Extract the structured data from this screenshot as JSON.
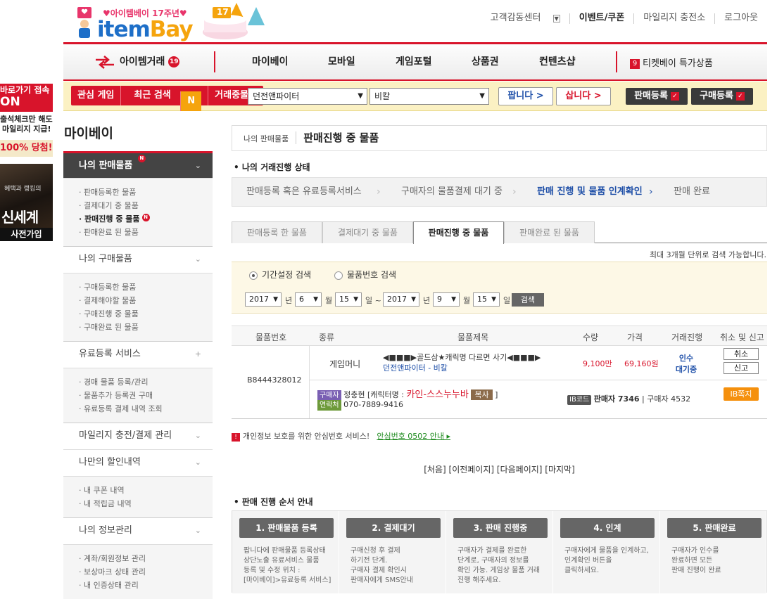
{
  "left_banners": {
    "banner1": {
      "line1": "바로가기 접속",
      "line2": "ON",
      "line3": "출석체크만 해도",
      "line4": "마일리지 지급!",
      "line5": "100% 당첨!"
    },
    "banner2": {
      "small": "혜택과 랭킹의",
      "big": "신세계",
      "cta": "사전가입"
    }
  },
  "logo": {
    "tagline": "♥아이템베이 17주년♥",
    "brand1": "item",
    "brand2": "Bay",
    "cake_number": "17"
  },
  "top_links": [
    "고객감동센터",
    "이벤트/쿠폰",
    "마일리지 충전소",
    "로그아웃"
  ],
  "nav": {
    "trade": "아이템거래",
    "trade_badge": "19",
    "items": [
      "마이베이",
      "모바일",
      "게임포털",
      "상품권",
      "컨텐츠샵"
    ],
    "ticket_num": "9",
    "ticket": "티켓베이 특가상품"
  },
  "search_bar": {
    "tabs": [
      "관심 게임",
      "최근 검색",
      "거래중물품"
    ],
    "new_badge": "N",
    "game_select": "던전앤파이터",
    "server_select": "비칼",
    "sell_btn": "팝니다 >",
    "buy_btn": "삽니다 >",
    "sell_reg": "판매등록",
    "buy_reg": "구매등록",
    "check": "✓"
  },
  "sidebar": {
    "title": "마이베이",
    "sections": [
      {
        "label": "나의 판매물품",
        "badge": "N",
        "items": [
          "· 판매등록한 물품",
          "· 결제대기 중 물품",
          "· 판매진행 중 물품",
          "· 판매완료 된 물품"
        ]
      },
      {
        "label": "나의 구매물품",
        "items": [
          "· 구매등록한 물품",
          "· 결제해야할 물품",
          "· 구매진행 중 물품",
          "· 구매완료 된 물품"
        ]
      },
      {
        "label": "유료등록 서비스",
        "items": [
          "· 경매 물품 등록/관리",
          "· 물품추가 등록권 구매",
          "· 유료등록 결제 내역 조회"
        ]
      },
      {
        "label": "마일리지 충전/결제 관리"
      },
      {
        "label": "나만의 할인내역",
        "items": [
          "· 내 쿠폰 내역",
          "· 내 적립금 내역"
        ]
      },
      {
        "label": "나의 정보관리",
        "items": [
          "· 계좌/회원정보 관리",
          "· 보상마크 상태 관리",
          "· 내 인증상태 관리"
        ]
      }
    ],
    "current_badge": "N"
  },
  "breadcrumb": {
    "parent": "나의 판매물품",
    "current": "판매진행 중 물품"
  },
  "status_section": {
    "title": "• 나의 거래진행 상태",
    "steps": [
      "판매등록 혹은 유료등록서비스",
      "구매자의 물품결제 대기 중",
      "판매 진행 및 물품 인계확인",
      "판매 완료"
    ],
    "sep": "›"
  },
  "tabs": [
    "판매등록 한 물품",
    "결제대기 중 물품",
    "판매진행 중 물품",
    "판매완료 된 물품"
  ],
  "search_note": "최대 3개월 단위로 검색 가능합니다.",
  "filter": {
    "radio1": "기간설정 검색",
    "radio2": "물품번호 검색",
    "from_year": "2017",
    "from_month": "6",
    "from_day": "15",
    "to_year": "2017",
    "to_month": "9",
    "to_day": "15",
    "unit_year": "년",
    "unit_month": "월",
    "unit_day": "일",
    "tilde": "~",
    "search_btn": "검색"
  },
  "table": {
    "headers": [
      "물품번호",
      "종류",
      "물품제목",
      "수량",
      "가격",
      "거래진행",
      "취소 및 신고"
    ],
    "row": {
      "item_no": "B8444328012",
      "type": "게임머니",
      "title": "◀■■■▶골드삼★캐릭명 다르면 사기◀■■■▶",
      "game": "던전앤파이터 - 비칼",
      "qty": "9,100만",
      "price": "69,160원",
      "status1": "인수",
      "status2": "대기중",
      "cancel": "취소",
      "report": "신고",
      "buyer_tag": "구매자",
      "buyer_name": "정충현 [캐릭터명 :",
      "char_name": "카인-스스누누바",
      "copy": "복사",
      "close_bracket": "]",
      "contact_tag": "연락처",
      "phone": "070-7889-9416",
      "ib_code_tag": "IB코드",
      "seller_code": "판매자 7346",
      "buyer_code": "| 구매자 4532",
      "ib_msg": "IB쪽지"
    }
  },
  "safe_notice": {
    "icon": "!",
    "text": "개인정보 보호를 위한 안심번호 서비스!",
    "link": "안심번호 0502 안내 ▸"
  },
  "pager": "[처음] [이전페이지] [다음페이지] [마지막]",
  "guide": {
    "title": "• 판매 진행 순서 안내",
    "steps": [
      {
        "title": "1. 판매물품 등록",
        "desc": "팝니다에 판매물품 등록상태\n상단노출 유료서비스 물품\n등록 및 수정 위치 :\n[마이베이]>유료등록 서비스]"
      },
      {
        "title": "2. 결제대기",
        "desc": "구매신청 후 결제\n하기전 단계.\n구매자 결제 확인시\n판매자에게 SMS안내"
      },
      {
        "title": "3. 판매 진행중",
        "desc": "구매자가 결제를 완료한\n단계로, 구매자의 정보를\n확인 가능. 게임상 물품 거래\n진행 해주세요."
      },
      {
        "title": "4. 인계",
        "desc": "구매자에게 물품을 인계하고,\n인계확인 버튼을\n클릭하세요."
      },
      {
        "title": "5. 판매완료",
        "desc": "구매자가 인수를\n완료하면 모든\n판매 진행이 완료"
      }
    ]
  }
}
